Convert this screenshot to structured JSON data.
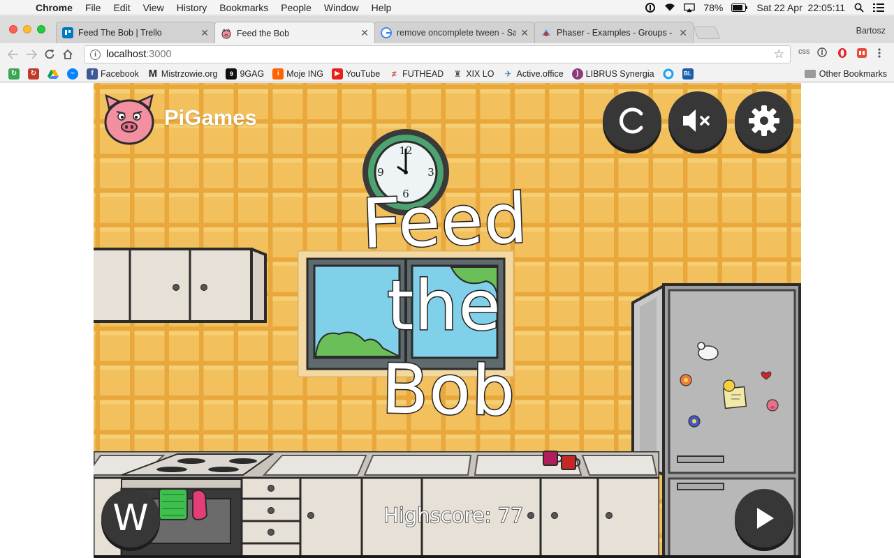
{
  "menubar": {
    "app": "Chrome",
    "items": [
      "File",
      "Edit",
      "View",
      "History",
      "Bookmarks",
      "People",
      "Window",
      "Help"
    ],
    "battery": "78%",
    "clock": "Sat 22 Apr  22:05:11"
  },
  "tabs": [
    {
      "title": "Feed The Bob | Trello",
      "icon": "trello-icon",
      "color": "#0079bf"
    },
    {
      "title": "Feed the Bob",
      "icon": "pig-icon",
      "color": "#f28fa0"
    },
    {
      "title": "remove oncomplete tween - Sa",
      "icon": "google-icon",
      "color": "#4285f4"
    },
    {
      "title": "Phaser - Examples - Groups - ",
      "icon": "phaser-icon",
      "color": "#b23b3b"
    }
  ],
  "profile": "Bartosz",
  "address": {
    "host": "localhost",
    "port": ":3000"
  },
  "extensions": [
    "css"
  ],
  "bookmarks": [
    {
      "label": "",
      "icon": "green-ext-icon",
      "color": "#3aa757"
    },
    {
      "label": "",
      "icon": "red-ext-icon",
      "color": "#c0392b"
    },
    {
      "label": "",
      "icon": "drive-icon",
      "color": "#f4b400"
    },
    {
      "label": "",
      "icon": "messenger-icon",
      "color": "#0084ff"
    },
    {
      "label": "Facebook",
      "icon": "facebook-icon",
      "color": "#3b5998"
    },
    {
      "label": "Mistrzowie.org",
      "icon": "m-icon",
      "color": "#222222"
    },
    {
      "label": "9GAG",
      "icon": "9gag-icon",
      "color": "#111111"
    },
    {
      "label": "Moje ING",
      "icon": "ing-icon",
      "color": "#ff6200"
    },
    {
      "label": "YouTube",
      "icon": "youtube-icon",
      "color": "#e62117"
    },
    {
      "label": "FUTHEAD",
      "icon": "futhead-icon",
      "color": "#c0392b"
    },
    {
      "label": "XIX LO",
      "icon": "school-icon",
      "color": "#555555"
    },
    {
      "label": "Active.office",
      "icon": "active-office-icon",
      "color": "#2a7ab8"
    },
    {
      "label": "LIBRUS Synergia",
      "icon": "librus-icon",
      "color": "#8e3b7a"
    },
    {
      "label": "",
      "icon": "circle-ext-icon",
      "color": "#1da1f2"
    },
    {
      "label": "",
      "icon": "bl-icon",
      "color": "#1c5fa8"
    }
  ],
  "other_bookmarks": "Other Bookmarks",
  "game": {
    "brand": "PiGames",
    "title": [
      "Feed",
      "the",
      "Bob"
    ],
    "highscore": "Highscore: 77",
    "w_button": "W",
    "clock_numbers": {
      "top": "12",
      "left": "9",
      "right": "3",
      "bottom": "6"
    }
  }
}
